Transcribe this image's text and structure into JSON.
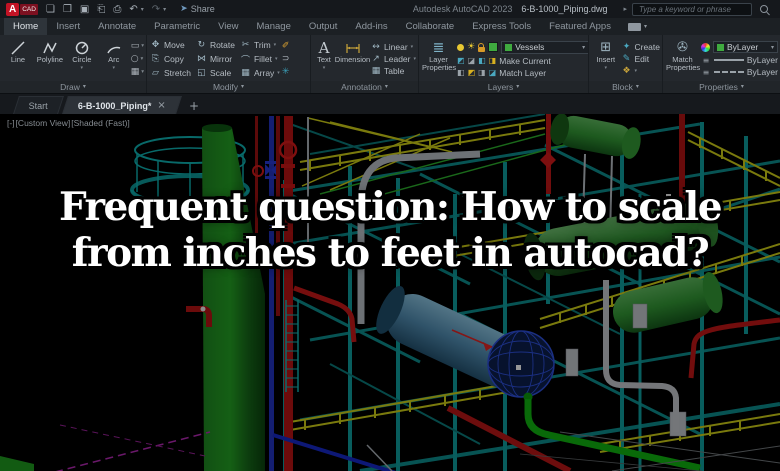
{
  "titlebar": {
    "logo_primary": "A",
    "logo_secondary": "CAD",
    "share_label": "Share",
    "app_title": "Autodesk AutoCAD 2023",
    "document_title": "6-B-1000_Piping.dwg",
    "search_placeholder": "Type a keyword or phrase"
  },
  "ribbon_tabs": {
    "active": "Home",
    "items": [
      "Home",
      "Insert",
      "Annotate",
      "Parametric",
      "View",
      "Manage",
      "Output",
      "Add-ins",
      "Collaborate",
      "Express Tools",
      "Featured Apps"
    ]
  },
  "panels": {
    "draw": {
      "label": "Draw",
      "tools": [
        "Line",
        "Polyline",
        "Circle",
        "Arc"
      ]
    },
    "modify": {
      "label": "Modify",
      "col1": [
        "Move",
        "Copy",
        "Stretch"
      ],
      "col2": [
        "Rotate",
        "Mirror",
        "Scale"
      ],
      "col3": [
        "Trim",
        "Fillet",
        "Array"
      ]
    },
    "annotation": {
      "label": "Annotation",
      "text_tool": "Text",
      "dimension_tool": "Dimension",
      "rows": [
        "Linear",
        "Leader",
        "Table"
      ]
    },
    "layers": {
      "label": "Layers",
      "layer_properties": "Layer Properties",
      "current_layer": "Vessels",
      "make_current": "Make Current",
      "match_layer": "Match Layer"
    },
    "block": {
      "label": "Block",
      "insert": "Insert",
      "create": "Create",
      "edit": "Edit"
    },
    "properties": {
      "label": "Properties",
      "match_properties": "Match Properties",
      "color_value": "ByLayer",
      "lineweight_value": "ByLayer",
      "linetype_value": "ByLayer"
    }
  },
  "file_tabs": {
    "start": "Start",
    "drawing": "6-B-1000_Piping*",
    "close": "×",
    "new_tab": "+"
  },
  "viewport": {
    "vp_control": "[-]",
    "view_control": "[Custom View]",
    "style_control": "[Shaded (Fast)]",
    "title_line1": "Frequent question: How to scale",
    "title_line2": "from inches to feet in autocad?"
  },
  "glyphs": {
    "new": "❏",
    "open": "❒",
    "save": "▣",
    "save_as": "⎗",
    "plot": "⎙",
    "undo": "↶",
    "redo": "↷",
    "share": "➤",
    "dropdown": "▾",
    "search_caret": "▸",
    "move": "✥",
    "copy": "⎘",
    "stretch": "▱",
    "rotate": "↻",
    "mirror": "⋈",
    "scale": "◱",
    "trim": "✂",
    "fillet": "⌒",
    "array": "▦",
    "erase": "✐",
    "offset": "⊃",
    "explode": "✳",
    "rect_tool": "▭",
    "ellipse_tool": "○",
    "hatch_tool": "▦",
    "text": "A",
    "linear": "↔",
    "leader": "↗",
    "table": "▦",
    "layer_stack": "≣",
    "layer_tool1": "◩",
    "layer_tool2": "◪",
    "layer_tool3": "◧",
    "layer_tool4": "◨",
    "insert": "⊞",
    "create": "✦",
    "edit": "✎",
    "block_attr": "❖",
    "match_props": "✇",
    "lineweight": "≡"
  },
  "colors": {
    "layer_vessels_swatch": "#3faa3f",
    "bylayer_swatch": "#3faa3f",
    "vessel_green": "#2e8a30",
    "structure_teal": "#0d8f8f",
    "railing_yellow": "#bcbc15",
    "pipe_red": "#b01515",
    "exchanger_blue": "#2a49c8",
    "viewport_background": "#000000"
  }
}
